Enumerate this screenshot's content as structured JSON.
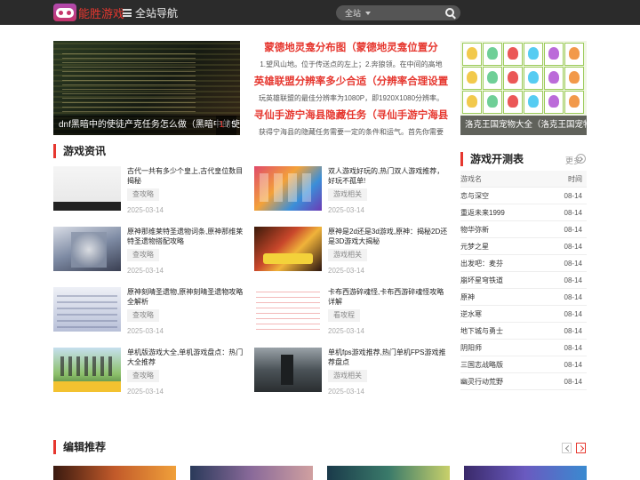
{
  "header": {
    "logo_text": "能胜游戏",
    "nav_label": "全站导航",
    "search_scope": "全站",
    "search_placeholder": ""
  },
  "slider": {
    "caption": "dnf黑暗中的使徒产克任务怎么做（黑暗中的使徒卢克",
    "page_current": "1",
    "page_total": "/ 5"
  },
  "headlines": [
    {
      "title": "蒙德地灵龛分布图（蒙德地灵龛位置分",
      "desc": "1.望风山地。位于传送点的左上；2.奔狼领。在中间的高地"
    },
    {
      "title": "英雄联盟分辨率多少合适（分辨率合理设置",
      "desc": "玩英雄联盟的最佳分辨率为1080P，即1920X1080分辨率。"
    },
    {
      "title": "寻仙手游宁海县隐藏任务（寻仙手游宁海县",
      "desc": "获得宁海县的隐藏任务需要一定的条件和运气。首先你需要"
    }
  ],
  "pet_panel": {
    "caption": "洛克王国宠物大全（洛克王国宠物大全 全"
  },
  "news_section": {
    "title": "游戏资讯"
  },
  "news": [
    {
      "title": "古代一共有多少个皇上,古代皇位数目揭秘",
      "tag": "查攻略",
      "date": "2025-03-14"
    },
    {
      "title": "双人游戏好玩的,热门双人游戏推荐，好玩不孤单!",
      "tag": "游戏相关",
      "date": "2025-03-14"
    },
    {
      "title": "原神那维莱特圣遗物词条,原神那维莱特圣遗物搭配攻略",
      "tag": "查攻略",
      "date": "2025-03-14"
    },
    {
      "title": "原神是2d还是3d游戏,原神：揭秘2D还是3D游戏大揭秘",
      "tag": "游戏相关",
      "date": "2025-03-14"
    },
    {
      "title": "原神刻晴圣遗物,原神刻晴圣遗物攻略全解析",
      "tag": "查攻略",
      "date": "2025-03-14"
    },
    {
      "title": "卡布西游碎魂怪,卡布西游碎魂怪攻略详解",
      "tag": "看攻程",
      "date": "2025-03-14"
    },
    {
      "title": "单机版游戏大全,单机游戏盘点：热门大全推荐",
      "tag": "查攻略",
      "date": "2025-03-14"
    },
    {
      "title": "单机fps游戏推荐,热门单机FPS游戏推荐盘点",
      "tag": "游戏相关",
      "date": "2025-03-14"
    }
  ],
  "ranking": {
    "title": "游戏开测表",
    "more": "更多",
    "col_name": "游戏名",
    "col_time": "时间",
    "rows": [
      {
        "name": "恋与深空",
        "date": "08-14"
      },
      {
        "name": "重返未来1999",
        "date": "08-14"
      },
      {
        "name": "物华弥新",
        "date": "08-14"
      },
      {
        "name": "元梦之星",
        "date": "08-14"
      },
      {
        "name": "出发吧：麦芬",
        "date": "08-14"
      },
      {
        "name": "崩坏星穹铁道",
        "date": "08-14"
      },
      {
        "name": "原神",
        "date": "08-14"
      },
      {
        "name": "逆水寒",
        "date": "08-14"
      },
      {
        "name": "地下城与勇士",
        "date": "08-14"
      },
      {
        "name": "阴阳师",
        "date": "08-14"
      },
      {
        "name": "三国志战略版",
        "date": "08-14"
      },
      {
        "name": "幽灵行动荒野",
        "date": "08-14"
      }
    ]
  },
  "editor_section": {
    "title": "编辑推荐"
  },
  "colors": {
    "accent": "#e6372f",
    "header_bg": "#2b2b2b"
  }
}
